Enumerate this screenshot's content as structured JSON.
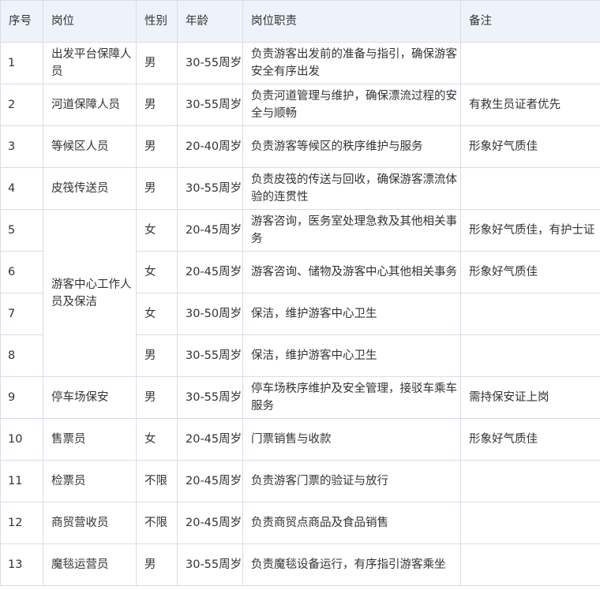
{
  "headers": [
    "序号",
    "岗位",
    "性别",
    "年龄",
    "岗位职责",
    "备注"
  ],
  "rows": [
    {
      "seq": "1",
      "post": "出发平台保障人员",
      "gender": "男",
      "age": "30-55周岁",
      "duty": "负责游客出发前的准备与指引，确保游客安全有序出发",
      "note": ""
    },
    {
      "seq": "2",
      "post": "河道保障人员",
      "gender": "男",
      "age": "30-55周岁",
      "duty": "负责河道管理与维护，确保漂流过程的安全与顺畅",
      "note": "有救生员证者优先"
    },
    {
      "seq": "3",
      "post": "等候区人员",
      "gender": "男",
      "age": "20-40周岁",
      "duty": "负责游客等候区的秩序维护与服务",
      "note": "形象好气质佳"
    },
    {
      "seq": "4",
      "post": "皮筏传送员",
      "gender": "男",
      "age": "30-55周岁",
      "duty": "负责皮筏的传送与回收，确保游客漂流体验的连贯性",
      "note": ""
    },
    {
      "seq": "5",
      "post": "游客中心工作人员及保洁",
      "gender": "女",
      "age": "20-45周岁",
      "duty": "游客咨询，医务室处理急救及其他相关事务",
      "note": "形象好气质佳，有护士证"
    },
    {
      "seq": "6",
      "post": "",
      "gender": "女",
      "age": "20-45周岁",
      "duty": "游客咨询、储物及游客中心其他相关事务",
      "note": "形象好气质佳"
    },
    {
      "seq": "7",
      "post": "",
      "gender": "女",
      "age": "30-50周岁",
      "duty": "保洁，维护游客中心卫生",
      "note": ""
    },
    {
      "seq": "8",
      "post": "",
      "gender": "男",
      "age": "30-55周岁",
      "duty": "保洁，维护游客中心卫生",
      "note": ""
    },
    {
      "seq": "9",
      "post": "停车场保安",
      "gender": "男",
      "age": "30-55周岁",
      "duty": "停车场秩序维护及安全管理，接驳车乘车服务",
      "note": "需持保安证上岗"
    },
    {
      "seq": "10",
      "post": "售票员",
      "gender": "女",
      "age": "20-45周岁",
      "duty": "门票销售与收款",
      "note": "形象好气质佳"
    },
    {
      "seq": "11",
      "post": "检票员",
      "gender": "不限",
      "age": "20-45周岁",
      "duty": "负责游客门票的验证与放行",
      "note": ""
    },
    {
      "seq": "12",
      "post": "商贸营收员",
      "gender": "不限",
      "age": "20-45周岁",
      "duty": "负责商贸点商品及食品销售",
      "note": ""
    },
    {
      "seq": "13",
      "post": "魔毯运营员",
      "gender": "男",
      "age": "30-55周岁",
      "duty": "负责魔毯设备运行，有序指引游客乘坐",
      "note": ""
    }
  ]
}
